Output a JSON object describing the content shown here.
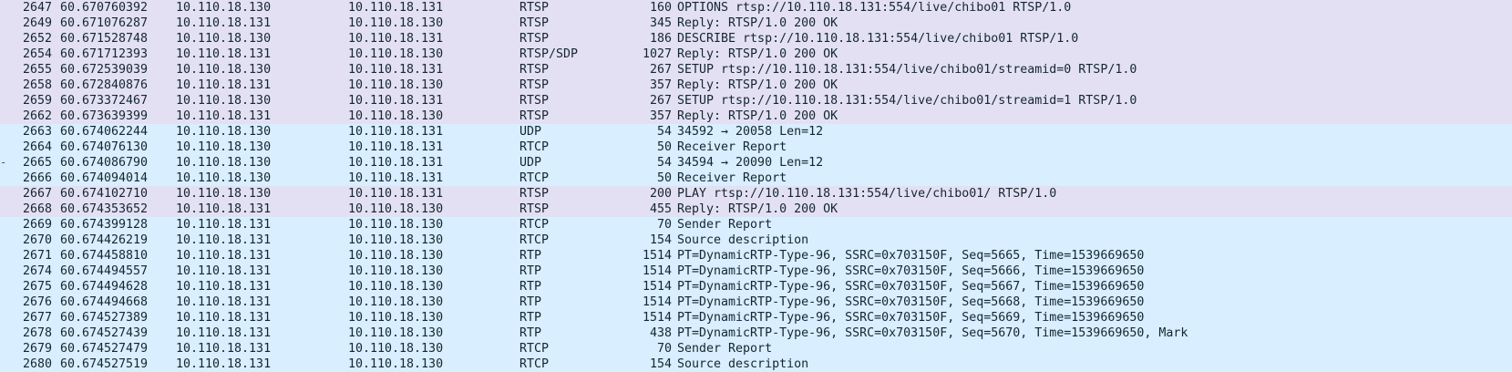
{
  "packets": [
    {
      "no": "2647",
      "time": "60.670760392",
      "src": "10.110.18.130",
      "dst": "10.110.18.131",
      "proto": "RTSP",
      "len": "160",
      "info": "OPTIONS rtsp://10.110.18.131:554/live/chibo01 RTSP/1.0"
    },
    {
      "no": "2649",
      "time": "60.671076287",
      "src": "10.110.18.131",
      "dst": "10.110.18.130",
      "proto": "RTSP",
      "len": "345",
      "info": "Reply: RTSP/1.0 200 OK"
    },
    {
      "no": "2652",
      "time": "60.671528748",
      "src": "10.110.18.130",
      "dst": "10.110.18.131",
      "proto": "RTSP",
      "len": "186",
      "info": "DESCRIBE rtsp://10.110.18.131:554/live/chibo01 RTSP/1.0"
    },
    {
      "no": "2654",
      "time": "60.671712393",
      "src": "10.110.18.131",
      "dst": "10.110.18.130",
      "proto": "RTSP/SDP",
      "len": "1027",
      "info": "Reply: RTSP/1.0 200 OK"
    },
    {
      "no": "2655",
      "time": "60.672539039",
      "src": "10.110.18.130",
      "dst": "10.110.18.131",
      "proto": "RTSP",
      "len": "267",
      "info": "SETUP rtsp://10.110.18.131:554/live/chibo01/streamid=0 RTSP/1.0"
    },
    {
      "no": "2658",
      "time": "60.672840876",
      "src": "10.110.18.131",
      "dst": "10.110.18.130",
      "proto": "RTSP",
      "len": "357",
      "info": "Reply: RTSP/1.0 200 OK"
    },
    {
      "no": "2659",
      "time": "60.673372467",
      "src": "10.110.18.130",
      "dst": "10.110.18.131",
      "proto": "RTSP",
      "len": "267",
      "info": "SETUP rtsp://10.110.18.131:554/live/chibo01/streamid=1 RTSP/1.0"
    },
    {
      "no": "2662",
      "time": "60.673639399",
      "src": "10.110.18.131",
      "dst": "10.110.18.130",
      "proto": "RTSP",
      "len": "357",
      "info": "Reply: RTSP/1.0 200 OK"
    },
    {
      "no": "2663",
      "time": "60.674062244",
      "src": "10.110.18.130",
      "dst": "10.110.18.131",
      "proto": "UDP",
      "len": "54",
      "info": "34592 → 20058 Len=12"
    },
    {
      "no": "2664",
      "time": "60.674076130",
      "src": "10.110.18.130",
      "dst": "10.110.18.131",
      "proto": "RTCP",
      "len": "50",
      "info": "Receiver Report"
    },
    {
      "no": "2665",
      "time": "60.674086790",
      "src": "10.110.18.130",
      "dst": "10.110.18.131",
      "proto": "UDP",
      "len": "54",
      "info": "34594 → 20090 Len=12"
    },
    {
      "no": "2666",
      "time": "60.674094014",
      "src": "10.110.18.130",
      "dst": "10.110.18.131",
      "proto": "RTCP",
      "len": "50",
      "info": "Receiver Report"
    },
    {
      "no": "2667",
      "time": "60.674102710",
      "src": "10.110.18.130",
      "dst": "10.110.18.131",
      "proto": "RTSP",
      "len": "200",
      "info": "PLAY rtsp://10.110.18.131:554/live/chibo01/ RTSP/1.0"
    },
    {
      "no": "2668",
      "time": "60.674353652",
      "src": "10.110.18.131",
      "dst": "10.110.18.130",
      "proto": "RTSP",
      "len": "455",
      "info": "Reply: RTSP/1.0 200 OK"
    },
    {
      "no": "2669",
      "time": "60.674399128",
      "src": "10.110.18.131",
      "dst": "10.110.18.130",
      "proto": "RTCP",
      "len": "70",
      "info": "Sender Report"
    },
    {
      "no": "2670",
      "time": "60.674426219",
      "src": "10.110.18.131",
      "dst": "10.110.18.130",
      "proto": "RTCP",
      "len": "154",
      "info": "Source description"
    },
    {
      "no": "2671",
      "time": "60.674458810",
      "src": "10.110.18.131",
      "dst": "10.110.18.130",
      "proto": "RTP",
      "len": "1514",
      "info": "PT=DynamicRTP-Type-96, SSRC=0x703150F, Seq=5665, Time=1539669650"
    },
    {
      "no": "2674",
      "time": "60.674494557",
      "src": "10.110.18.131",
      "dst": "10.110.18.130",
      "proto": "RTP",
      "len": "1514",
      "info": "PT=DynamicRTP-Type-96, SSRC=0x703150F, Seq=5666, Time=1539669650"
    },
    {
      "no": "2675",
      "time": "60.674494628",
      "src": "10.110.18.131",
      "dst": "10.110.18.130",
      "proto": "RTP",
      "len": "1514",
      "info": "PT=DynamicRTP-Type-96, SSRC=0x703150F, Seq=5667, Time=1539669650"
    },
    {
      "no": "2676",
      "time": "60.674494668",
      "src": "10.110.18.131",
      "dst": "10.110.18.130",
      "proto": "RTP",
      "len": "1514",
      "info": "PT=DynamicRTP-Type-96, SSRC=0x703150F, Seq=5668, Time=1539669650"
    },
    {
      "no": "2677",
      "time": "60.674527389",
      "src": "10.110.18.131",
      "dst": "10.110.18.130",
      "proto": "RTP",
      "len": "1514",
      "info": "PT=DynamicRTP-Type-96, SSRC=0x703150F, Seq=5669, Time=1539669650"
    },
    {
      "no": "2678",
      "time": "60.674527439",
      "src": "10.110.18.131",
      "dst": "10.110.18.130",
      "proto": "RTP",
      "len": "438",
      "info": "PT=DynamicRTP-Type-96, SSRC=0x703150F, Seq=5670, Time=1539669650, Mark"
    },
    {
      "no": "2679",
      "time": "60.674527479",
      "src": "10.110.18.131",
      "dst": "10.110.18.130",
      "proto": "RTCP",
      "len": "70",
      "info": "Sender Report"
    },
    {
      "no": "2680",
      "time": "60.674527519",
      "src": "10.110.18.131",
      "dst": "10.110.18.130",
      "proto": "RTCP",
      "len": "154",
      "info": "Source description"
    }
  ],
  "colors": {
    "rtsp_row": "#e4e0f4",
    "udp_rtp_row": "#d9eeff",
    "text": "#12272e"
  }
}
